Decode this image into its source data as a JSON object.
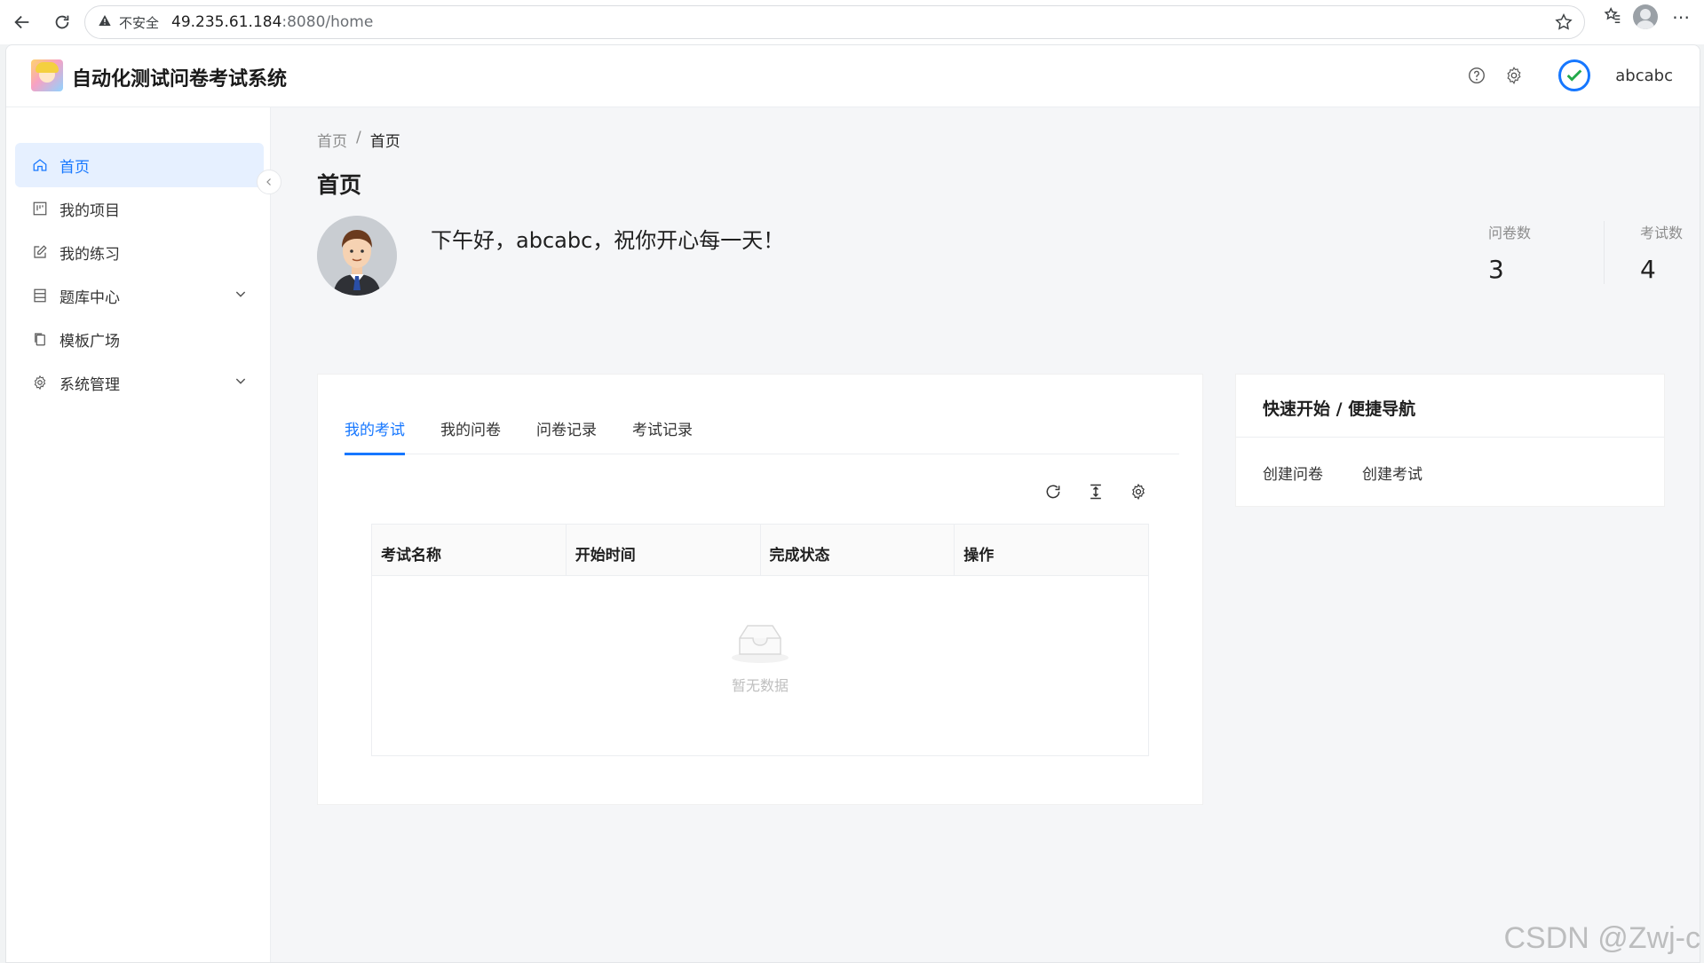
{
  "browser": {
    "security_label": "不安全",
    "url_host": "49.235.61.184",
    "url_path": ":8080/home"
  },
  "app": {
    "title": "自动化测试问卷考试系统",
    "username": "abcabc"
  },
  "sidebar": {
    "items": [
      {
        "label": "首页",
        "icon": "home-icon"
      },
      {
        "label": "我的项目",
        "icon": "project-icon"
      },
      {
        "label": "我的练习",
        "icon": "edit-icon"
      },
      {
        "label": "题库中心",
        "icon": "database-icon"
      },
      {
        "label": "模板广场",
        "icon": "copy-icon"
      },
      {
        "label": "系统管理",
        "icon": "gear-icon"
      }
    ]
  },
  "main": {
    "breadcrumb": [
      "首页",
      "首页"
    ],
    "breadcrumb_sep": "/",
    "page_title": "首页",
    "greeting": "下午好，abcabc，祝你开心每一天！",
    "stats": [
      {
        "label": "问卷数",
        "value": "3"
      },
      {
        "label": "考试数",
        "value": "4"
      }
    ],
    "tabs": [
      "我的考试",
      "我的问卷",
      "问卷记录",
      "考试记录"
    ],
    "table_headers": [
      "考试名称",
      "开始时间",
      "完成状态",
      "操作"
    ],
    "empty_text": "暂无数据",
    "quick": {
      "title": "快速开始 / 便捷导航",
      "links": [
        "创建问卷",
        "创建考试"
      ]
    }
  },
  "watermark": "CSDN @Zwj-c",
  "colors": {
    "accent": "#1677ff",
    "active_bg": "#e6f0ff"
  }
}
